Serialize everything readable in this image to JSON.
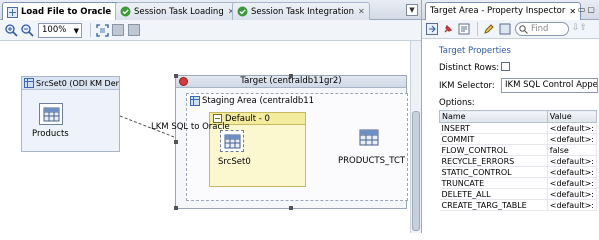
{
  "editor": {
    "tabs": [
      {
        "label": "Load File to Oracle",
        "active": true
      },
      {
        "label": "Session Task Loading",
        "active": false
      },
      {
        "label": "Session Task Integration",
        "active": false
      }
    ],
    "zoom": "100%"
  },
  "diagram": {
    "source_set": {
      "title": "SrcSet0 (ODI KM Dem",
      "datastore": "Products"
    },
    "target": {
      "title": "Target (centraldb11gr2)"
    },
    "staging": {
      "title": "Staging Area (centraldb11"
    },
    "default_group": {
      "title": "Default - 0",
      "datastore": "SrcSet0"
    },
    "load_label": "LKM SQL to Oracle",
    "target_datastore": "PRODUCTS_TCT"
  },
  "inspector": {
    "title": "Target Area - Property Inspector",
    "find_placeholder": "Find",
    "section_title": "Target Properties",
    "distinct_rows_label": "Distinct Rows:",
    "ikm_selector_label": "IKM Selector:",
    "ikm_selector_value": "IKM SQL Control Append",
    "options_label": "Options:",
    "columns": [
      "Name",
      "Value"
    ],
    "options": [
      {
        "name": "INSERT",
        "value": "<default>:"
      },
      {
        "name": "COMMIT",
        "value": "<default>:"
      },
      {
        "name": "FLOW_CONTROL",
        "value": "false"
      },
      {
        "name": "RECYCLE_ERRORS",
        "value": "<default>:"
      },
      {
        "name": "STATIC_CONTROL",
        "value": "<default>:"
      },
      {
        "name": "TRUNCATE",
        "value": "<default>:"
      },
      {
        "name": "DELETE_ALL",
        "value": "<default>:"
      },
      {
        "name": "CREATE_TARG_TABLE",
        "value": "<default>:"
      }
    ]
  }
}
